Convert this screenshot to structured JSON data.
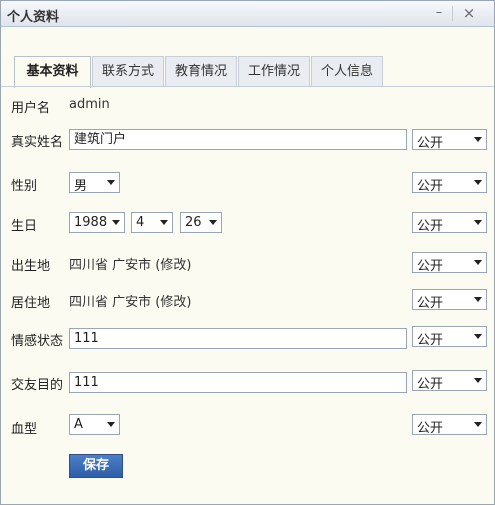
{
  "window": {
    "title": "个人资料",
    "min_glyph": "–",
    "close_glyph": "×"
  },
  "tabs": [
    {
      "label": "基本资料",
      "active": true
    },
    {
      "label": "联系方式",
      "active": false
    },
    {
      "label": "教育情况",
      "active": false
    },
    {
      "label": "工作情况",
      "active": false
    },
    {
      "label": "个人信息",
      "active": false
    }
  ],
  "form": {
    "username": {
      "label": "用户名",
      "value": "admin"
    },
    "realname": {
      "label": "真实姓名",
      "value": "建筑门户",
      "privacy": "公开"
    },
    "gender": {
      "label": "性别",
      "value": "男",
      "privacy": "公开"
    },
    "birthday": {
      "label": "生日",
      "year": "1988",
      "month": "4",
      "day": "26",
      "privacy": "公开"
    },
    "birthplace": {
      "label": "出生地",
      "value": "四川省 广安市 (修改)",
      "privacy": "公开"
    },
    "residence": {
      "label": "居住地",
      "value": "四川省 广安市 (修改)",
      "privacy": "公开"
    },
    "emotion": {
      "label": "情感状态",
      "value": "111",
      "privacy": "公开"
    },
    "purpose": {
      "label": "交友目的",
      "value": "111",
      "privacy": "公开"
    },
    "bloodtype": {
      "label": "血型",
      "value": "A",
      "privacy": "公开"
    }
  },
  "save_label": "保存"
}
